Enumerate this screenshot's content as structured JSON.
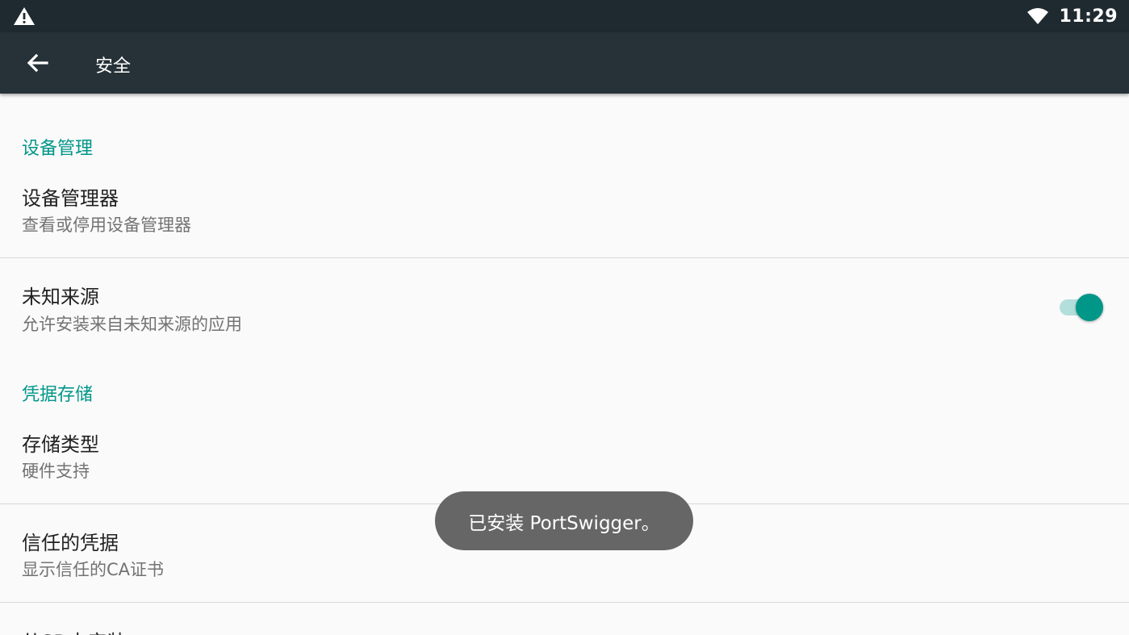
{
  "statusbar": {
    "warning_icon": "warning-icon",
    "wifi_icon": "wifi-icon",
    "time": "11:29"
  },
  "appbar": {
    "back_icon": "arrow-back-icon",
    "title": "安全"
  },
  "sections": {
    "device_admin": {
      "header": "设备管理",
      "item_title": "设备管理器",
      "item_summary": "查看或停用设备管理器"
    },
    "unknown_sources": {
      "title": "未知来源",
      "summary": "允许安装来自未知来源的应用",
      "switch_on": true
    },
    "credential_storage": {
      "header": "凭据存储",
      "storage_type_title": "存储类型",
      "storage_type_summary": "硬件支持",
      "trusted_title": "信任的凭据",
      "trusted_summary": "显示信任的CA证书",
      "install_sd_title": "从SD卡安装"
    }
  },
  "toast": {
    "text": "已安装 PortSwigger。"
  },
  "colors": {
    "statusbar": "#1f2a30",
    "appbar": "#263238",
    "accent": "#009688",
    "toast": "#666666"
  }
}
